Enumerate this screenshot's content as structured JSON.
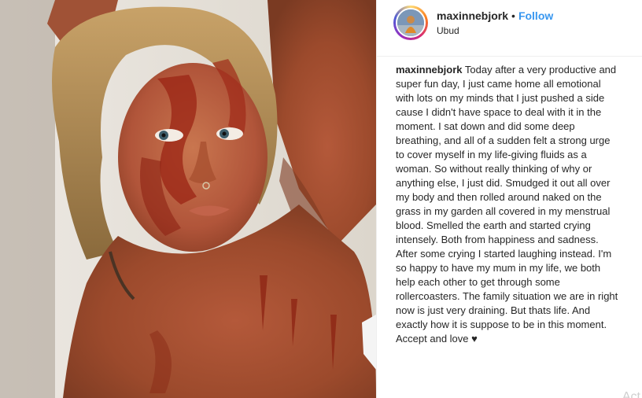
{
  "post": {
    "username": "maxinnebjork",
    "separator": "•",
    "follow_label": "Follow",
    "location": "Ubud",
    "caption_user": "maxinnebjork",
    "caption_text": "Today after a very productive and super fun day, I just came home all emotional with lots on my minds that I just pushed a side cause I didn't have space to deal with it in the moment. I sat down and did some deep breathing, and all of a sudden felt a strong urge to cover myself in my life-giving fluids as a woman. So without really thinking of why or anything else, I just did. Smudged it out all over my body and then rolled around naked on the grass in my garden all covered in my menstrual blood. Smelled the earth and started crying intensely. Both from happiness and sadness. After some crying I started laughing instead. I'm so happy to have my mum in my life, we both help each other to get through some rollercoasters. The family situation we are in right now is just very draining. But thats life. And exactly how it is suppose to be in this moment. Accept and love",
    "caption_heart": "♥"
  },
  "overlay": {
    "watermark": "Act"
  },
  "colors": {
    "link_blue": "#3897f0",
    "text_dark": "#262626",
    "border": "#efefef"
  },
  "icons": {
    "avatar": "profile-avatar-photo"
  }
}
